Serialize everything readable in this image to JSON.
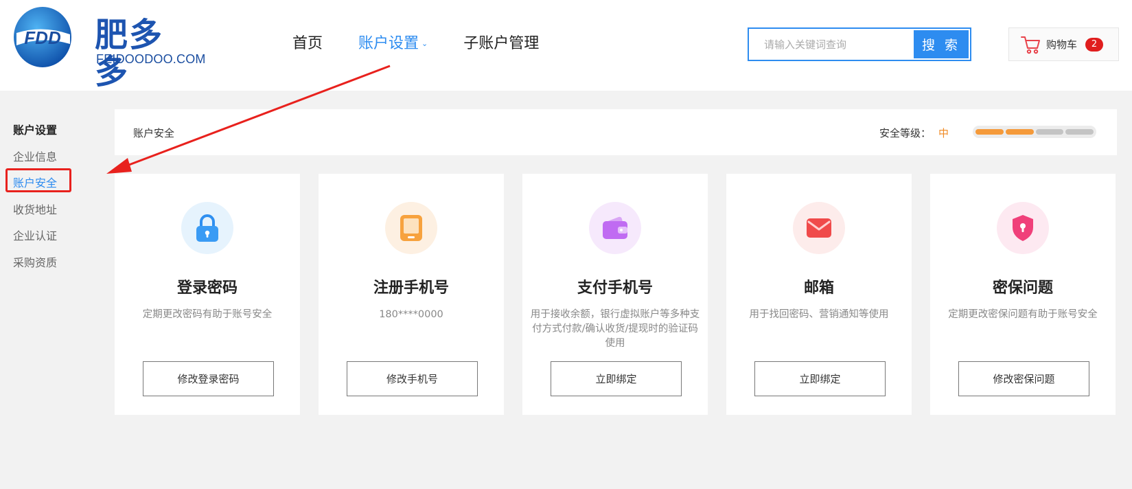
{
  "header": {
    "logo": {
      "mark_text": "FDD",
      "name_cn": "肥多多",
      "domain": "FEIDOODOO.COM"
    },
    "nav": [
      {
        "label": "首页",
        "active": false
      },
      {
        "label": "账户设置",
        "active": true
      },
      {
        "label": "子账户管理",
        "active": false
      }
    ],
    "search": {
      "placeholder": "请输入关键词查询",
      "value": "",
      "button_label": "搜 索"
    },
    "cart": {
      "label": "购物车",
      "count": "2"
    }
  },
  "sidebar": {
    "title": "账户设置",
    "items": [
      {
        "label": "企业信息",
        "active": false
      },
      {
        "label": "账户安全",
        "active": true
      },
      {
        "label": "收货地址",
        "active": false
      },
      {
        "label": "企业认证",
        "active": false
      },
      {
        "label": "采购资质",
        "active": false
      }
    ]
  },
  "main": {
    "section_title": "账户安全",
    "security_level": {
      "label": "安全等级：",
      "value": "中",
      "segments_total": 4,
      "segments_filled": 2
    },
    "cards": [
      {
        "icon": "lock-icon",
        "title": "登录密码",
        "description": "定期更改密码有助于账号安全",
        "button_label": "修改登录密码"
      },
      {
        "icon": "tablet-icon",
        "title": "注册手机号",
        "description": "180****0000",
        "button_label": "修改手机号"
      },
      {
        "icon": "wallet-icon",
        "title": "支付手机号",
        "description": "用于接收余额，银行虚拟账户等多种支付方式付款/确认收货/提现时的验证码使用",
        "button_label": "立即绑定"
      },
      {
        "icon": "mail-icon",
        "title": "邮箱",
        "description": "用于找回密码、营销通知等使用",
        "button_label": "立即绑定"
      },
      {
        "icon": "shield-icon",
        "title": "密保问题",
        "description": "定期更改密保问题有助于账号安全",
        "button_label": "修改密保问题"
      }
    ]
  },
  "colors": {
    "accent": "#2d8cf0",
    "level_orange": "#f59a3a",
    "annotation_red": "#e8211d",
    "lock_bg": "#e6f3fd",
    "tablet_bg": "#fdf0e2",
    "wallet_bg": "#f6e9fc",
    "mail_bg": "#fdeceb",
    "shield_bg": "#fde9f1"
  }
}
